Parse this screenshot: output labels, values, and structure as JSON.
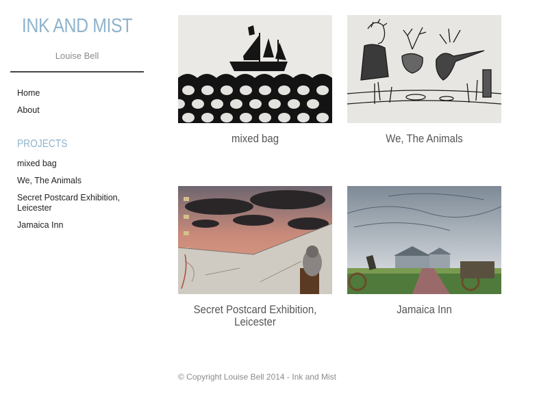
{
  "site": {
    "title": "INK AND MIST",
    "tagline": "Louise Bell"
  },
  "nav": {
    "items": [
      {
        "label": "Home"
      },
      {
        "label": "About"
      }
    ]
  },
  "projects": {
    "heading": "PROJECTS",
    "items": [
      {
        "label": "mixed bag"
      },
      {
        "label": "We, The Animals"
      },
      {
        "label": "Secret Postcard Exhibition, Leicester"
      },
      {
        "label": "Jamaica Inn"
      }
    ]
  },
  "gallery": {
    "tiles": [
      {
        "caption": "mixed bag",
        "image": "woodcut-ship-waves-image"
      },
      {
        "caption": "We, The Animals",
        "image": "animals-dinner-drawing-image"
      },
      {
        "caption": "Secret Postcard Exhibition, Leicester",
        "image": "collage-sunset-cat-image"
      },
      {
        "caption": "Jamaica Inn",
        "image": "inn-landscape-drawing-image"
      }
    ]
  },
  "footer": {
    "text": "© Copyright Louise Bell 2014 - Ink and Mist"
  },
  "colors": {
    "accent": "#8fb3cc",
    "text": "#222222",
    "muted": "#8a8a8a"
  }
}
